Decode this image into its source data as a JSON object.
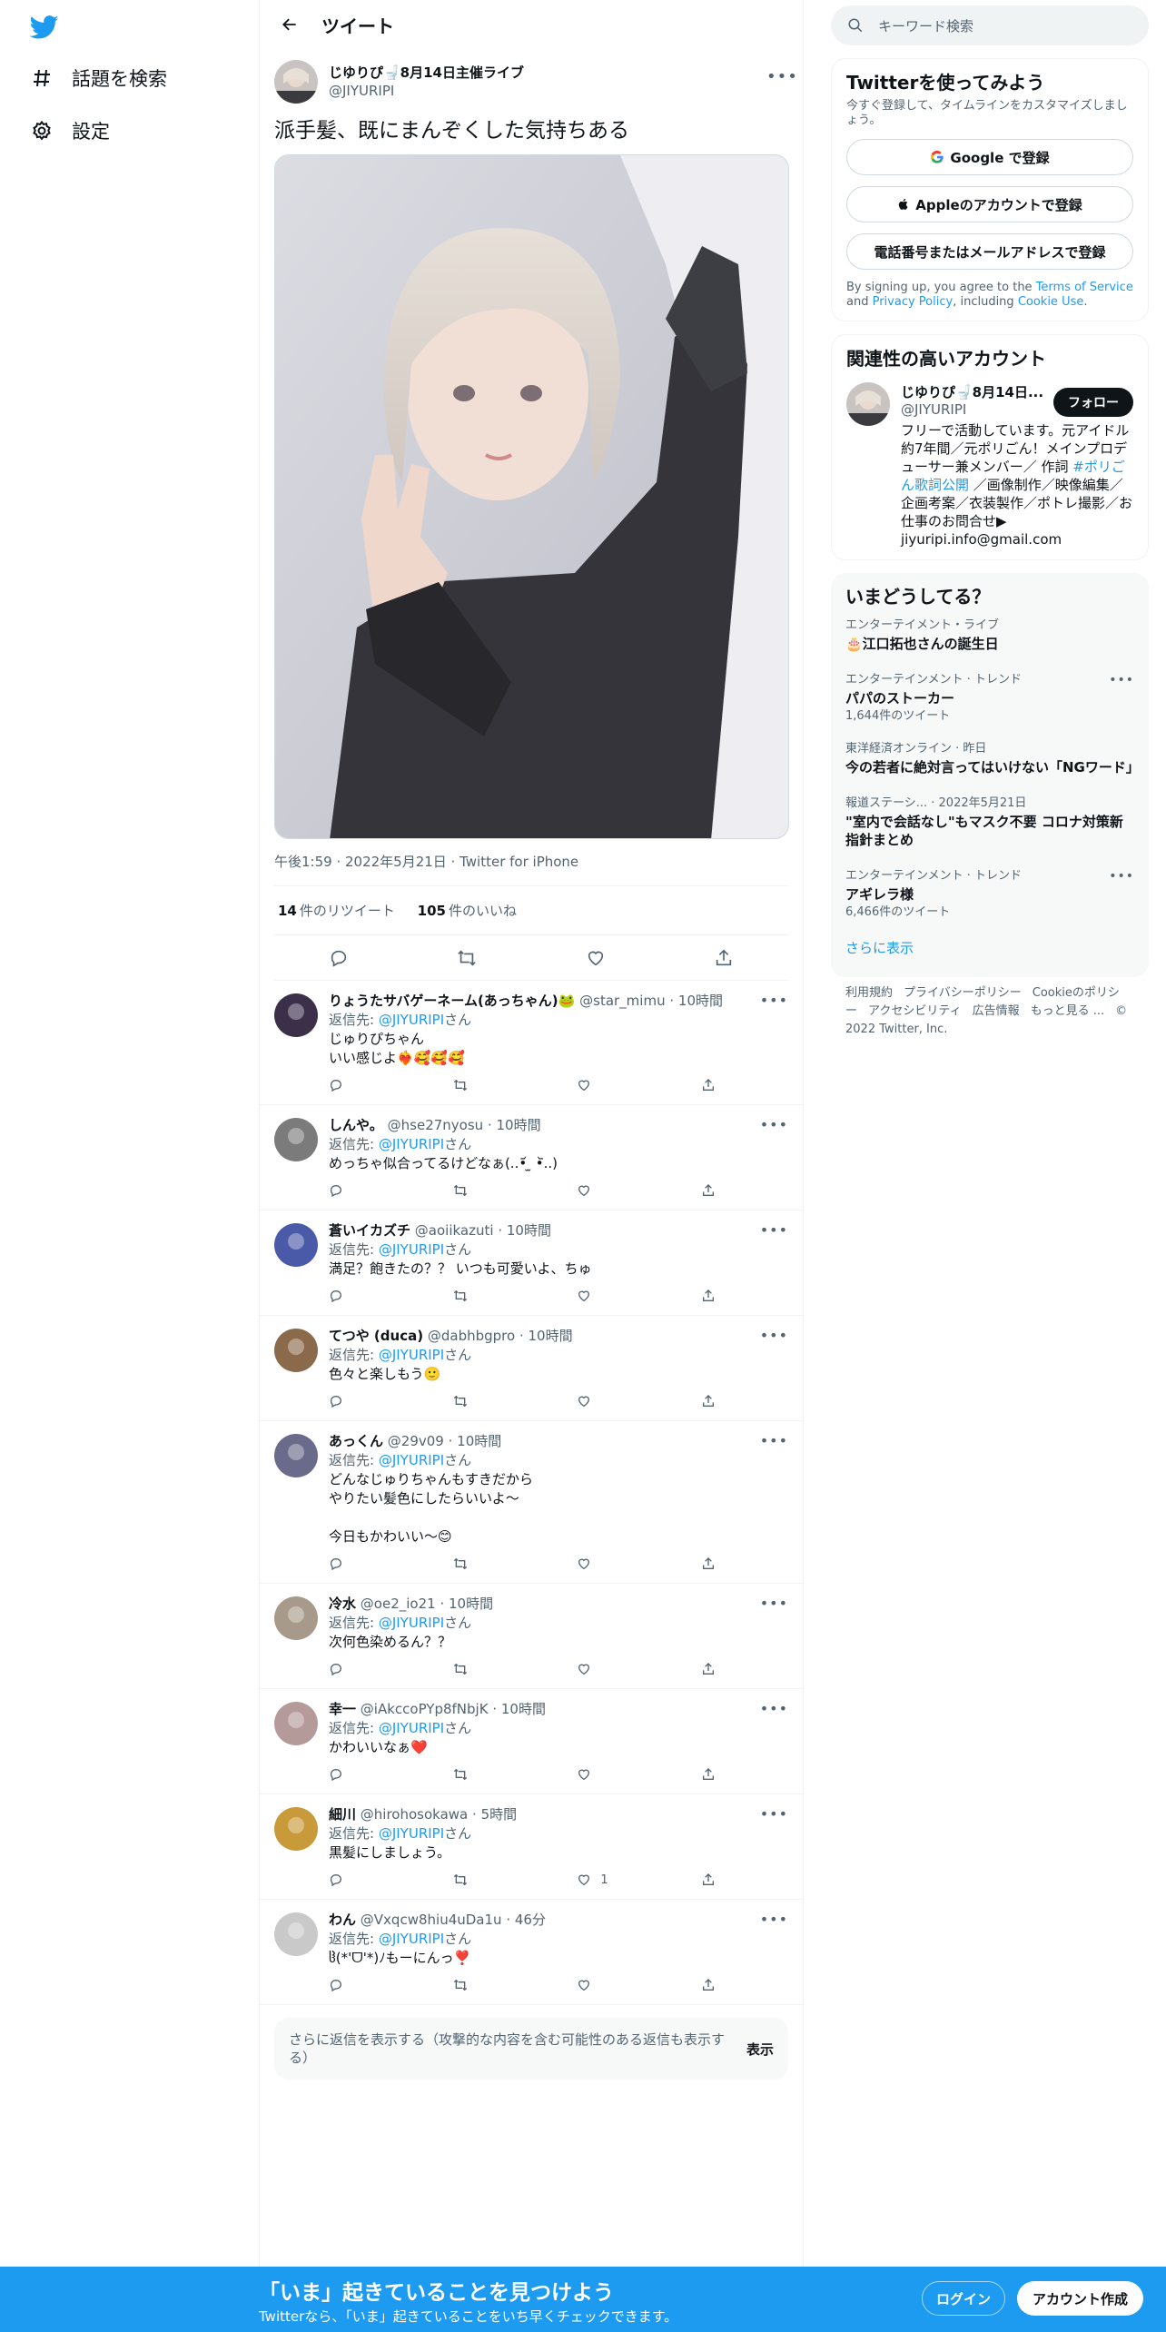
{
  "nav": {
    "explore_label": "話題を検索",
    "settings_label": "設定"
  },
  "header": {
    "title": "ツイート"
  },
  "tweet": {
    "author_name": "じゆりぴ🚽8月14日主催ライブ",
    "author_handle": "@JIYURIPI",
    "text": "派手髪、既にまんぞくした気持ちある",
    "timestamp": "午後1:59 · 2022年5月21日 · Twitter for iPhone",
    "retweets": "14",
    "retweets_label": "件のリツイート",
    "likes": "105",
    "likes_label": "件のいいね"
  },
  "replies": [
    {
      "name": "りょうたサバゲーネーム(あっちゃん)🐸",
      "handle": "@star_mimu",
      "time": "· 10時間",
      "reply_to": "@JIYURIPI",
      "reply_suffix": "さん",
      "reply_prefix": "返信先: ",
      "text": "じゅりぴちゃん\nいい感じよ❤️‍🔥🥰🥰🥰",
      "likes": ""
    },
    {
      "name": "しんや。",
      "handle": "@hse27nyosu",
      "time": "· 10時間",
      "reply_to": "@JIYURIPI",
      "reply_suffix": "さん",
      "reply_prefix": "返信先: ",
      "text": "めっちゃ似合ってるけどなぁ(..•᷄ ̫ •᷅..)",
      "likes": ""
    },
    {
      "name": "蒼いイカズチ",
      "handle": "@aoiikazuti",
      "time": "· 10時間",
      "reply_to": "@JIYURIPI",
      "reply_suffix": "さん",
      "reply_prefix": "返信先: ",
      "text": "満足？飽きたの？？ いつも可愛いよ、ちゅ",
      "likes": ""
    },
    {
      "name": "てつや (duca)",
      "handle": "@dabhbgpro",
      "time": "· 10時間",
      "reply_to": "@JIYURIPI",
      "reply_suffix": "さん",
      "reply_prefix": "返信先: ",
      "text": "色々と楽しもう🙂",
      "likes": ""
    },
    {
      "name": "あっくん",
      "handle": "@29v09",
      "time": "· 10時間",
      "reply_to": "@JIYURIPI",
      "reply_suffix": "さん",
      "reply_prefix": "返信先: ",
      "text": "どんなじゅりちゃんもすきだから\nやりたい髪色にしたらいいよ～\n\n今日もかわいい～😊",
      "likes": ""
    },
    {
      "name": "冷水",
      "handle": "@oe2_io21",
      "time": "· 10時間",
      "reply_to": "@JIYURIPI",
      "reply_suffix": "さん",
      "reply_prefix": "返信先: ",
      "text": "次何色染めるん？？",
      "likes": ""
    },
    {
      "name": "幸一",
      "handle": "@iAkccoPYp8fNbjK",
      "time": "· 10時間",
      "reply_to": "@JIYURIPI",
      "reply_suffix": "さん",
      "reply_prefix": "返信先: ",
      "text": "かわいいなぁ❤️",
      "likes": ""
    },
    {
      "name": "細川",
      "handle": "@hirohosokawa",
      "time": "· 5時間",
      "reply_to": "@JIYURIPI",
      "reply_suffix": "さん",
      "reply_prefix": "返信先: ",
      "text": "黒髪にしましょう。",
      "likes": "1"
    },
    {
      "name": "わん",
      "handle": "@Vxqcw8hiu4uDa1u",
      "time": "· 46分",
      "reply_to": "@JIYURIPI",
      "reply_suffix": "さん",
      "reply_prefix": "返信先: ",
      "text": "ჱ̒(*'ᗜ'*)ﾉもーにんっ❣️",
      "likes": ""
    }
  ],
  "show_more": {
    "text": "さらに返信を表示する（攻撃的な内容を含む可能性のある返信も表示する）",
    "button": "表示"
  },
  "search": {
    "placeholder": "キーワード検索"
  },
  "signup_card": {
    "title": "Twitterを使ってみよう",
    "subtitle": "今すぐ登録して、タイムラインをカスタマイズしましょう。",
    "google": "Google で登録",
    "apple": "Appleのアカウントで登録",
    "phone": "電話番号またはメールアドレスで登録",
    "legal_1": "By signing up, you agree to the ",
    "terms": "Terms of Service",
    "legal_2": " and ",
    "privacy": "Privacy Policy",
    "legal_3": ", including ",
    "cookie": "Cookie Use",
    "legal_4": "."
  },
  "related": {
    "title": "関連性の高いアカウント",
    "name": "じゆりぴ🚽8月14日...",
    "handle": "@JIYURIPI",
    "follow": "フォロー",
    "bio_1": "フリーで活動しています。元アイドル約7年間／元ポリごん！メインプロデューサー兼メンバー／ 作詞 ",
    "bio_link": "#ポリごん歌詞公開",
    "bio_2": " ／画像制作／映像編集／企画考案／衣装製作／ポトレ撮影／お仕事のお問合せ▶︎ jiyuripi.info@gmail.com"
  },
  "trends": {
    "title": "いまどうしてる？",
    "items": [
      {
        "category": "エンターテイメント・ライブ",
        "name": "🎂江口拓也さんの誕生日",
        "count": ""
      },
      {
        "category": "エンターテインメント · トレンド",
        "name": "パパのストーカー",
        "count": "1,644件のツイート"
      },
      {
        "category": "東洋経済オンライン · 昨日",
        "name": "今の若者に絶対言ってはいけない「NGワード」",
        "count": ""
      },
      {
        "category": "報道ステーシ... · 2022年5月21日",
        "name": "\"室内で会話なし\"もマスク不要 コロナ対策新指針まとめ",
        "count": ""
      },
      {
        "category": "エンターテインメント · トレンド",
        "name": "アギレラ様",
        "count": "6,466件のツイート"
      }
    ],
    "show_more": "さらに表示"
  },
  "footer": {
    "links": [
      "利用規約",
      "プライバシーポリシー",
      "Cookieのポリシー",
      "アクセシビリティ",
      "広告情報",
      "もっと見る ...",
      "© 2022 Twitter, Inc."
    ]
  },
  "bottom_bar": {
    "headline": "「いま」起きていることを見つけよう",
    "sub": "Twitterなら、「いま」起きていることをいち早くチェックできます。",
    "login": "ログイン",
    "signup": "アカウント作成"
  },
  "colors": {
    "accent": "#1d9bf0",
    "text": "#0f1419",
    "muted": "#536471"
  }
}
